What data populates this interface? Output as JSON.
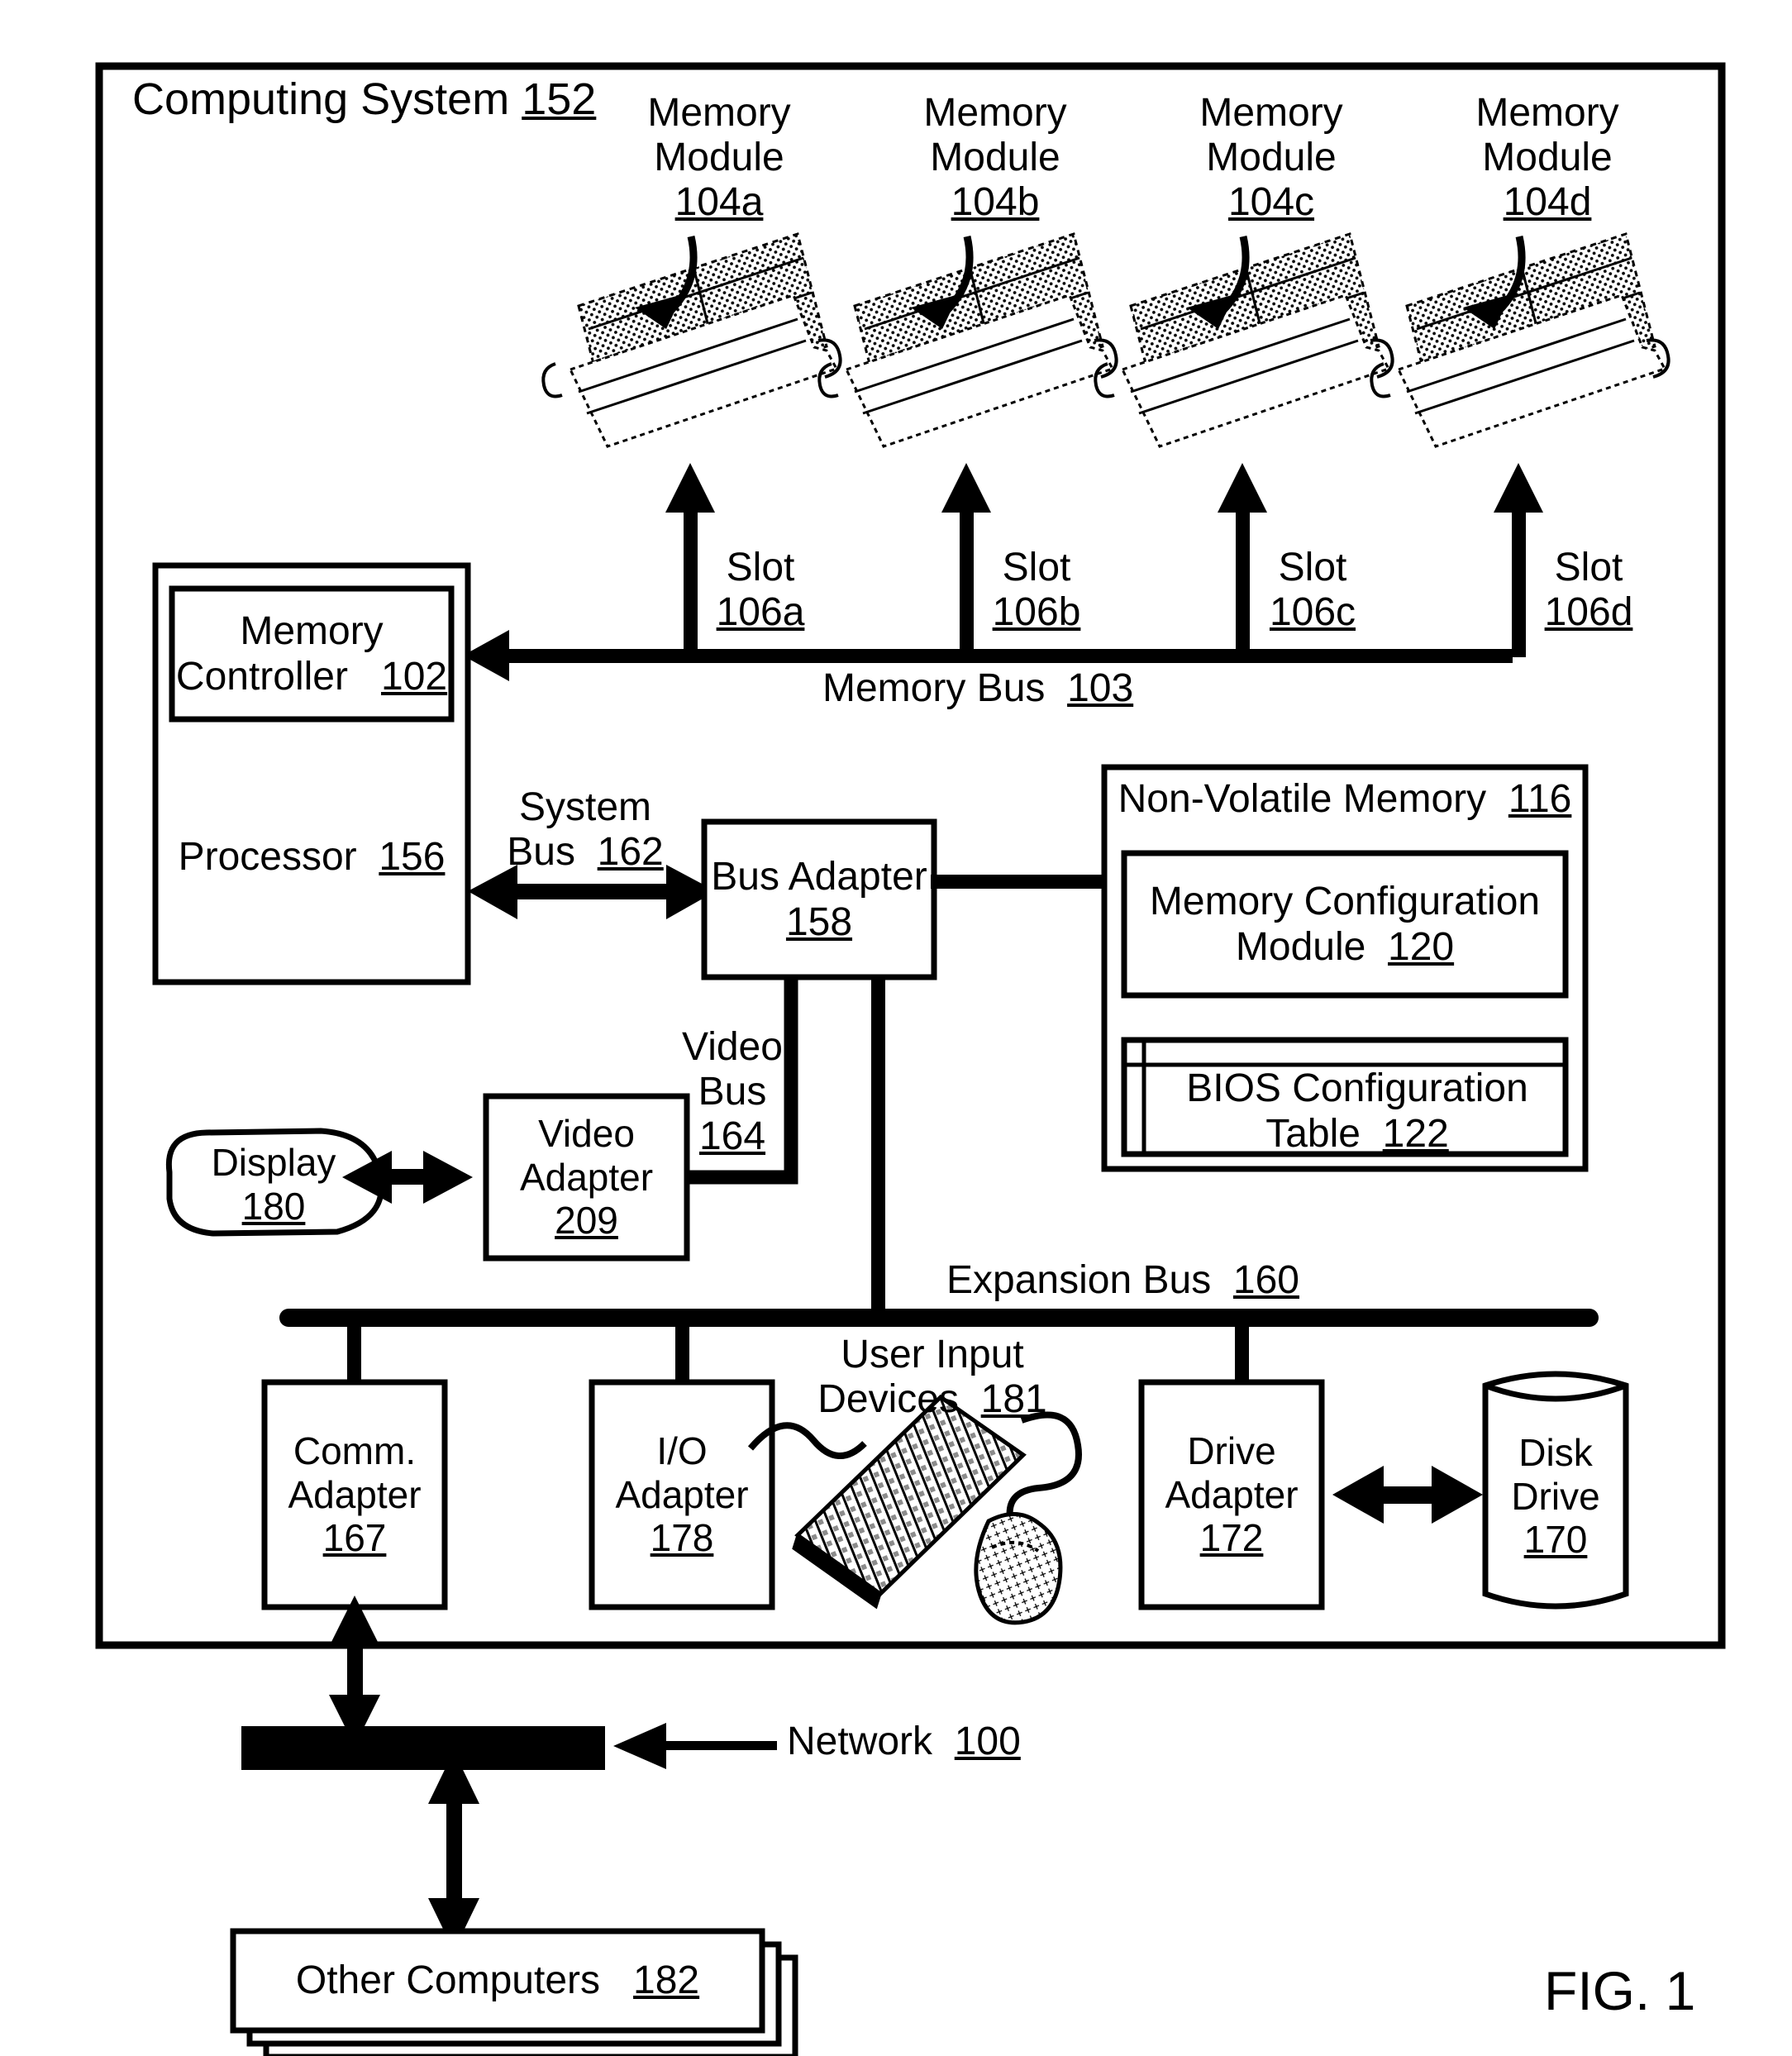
{
  "figure": {
    "caption": "FIG. 1",
    "system_title": "Computing System",
    "system_ref": "152"
  },
  "memory_modules": [
    {
      "line1": "Memory",
      "line2": "Module",
      "ref": "104a"
    },
    {
      "line1": "Memory",
      "line2": "Module",
      "ref": "104b"
    },
    {
      "line1": "Memory",
      "line2": "Module",
      "ref": "104c"
    },
    {
      "line1": "Memory",
      "line2": "Module",
      "ref": "104d"
    }
  ],
  "slots": [
    {
      "label": "Slot",
      "ref": "106a"
    },
    {
      "label": "Slot",
      "ref": "106b"
    },
    {
      "label": "Slot",
      "ref": "106c"
    },
    {
      "label": "Slot",
      "ref": "106d"
    }
  ],
  "buses": {
    "memory_bus": {
      "label": "Memory Bus",
      "ref": "103"
    },
    "system_bus": {
      "line1": "System",
      "line2": "Bus",
      "ref": "162"
    },
    "video_bus": {
      "line1": "Video",
      "line2": "Bus",
      "ref": "164"
    },
    "expansion_bus": {
      "label": "Expansion Bus",
      "ref": "160"
    },
    "network": {
      "label": "Network",
      "ref": "100"
    }
  },
  "blocks": {
    "memory_controller": {
      "line1": "Memory",
      "line2": "Controller",
      "ref": "102"
    },
    "processor": {
      "label": "Processor",
      "ref": "156"
    },
    "bus_adapter": {
      "label": "Bus Adapter",
      "ref": "158"
    },
    "non_volatile_memory": {
      "label": "Non-Volatile Memory",
      "ref": "116"
    },
    "memory_configuration_module": {
      "line1": "Memory Configuration",
      "line2": "Module",
      "ref": "120"
    },
    "bios_configuration_table": {
      "line1": "BIOS Configuration",
      "line2": "Table",
      "ref": "122"
    },
    "video_adapter": {
      "line1": "Video",
      "line2": "Adapter",
      "ref": "209"
    },
    "display": {
      "label": "Display",
      "ref": "180"
    },
    "comm_adapter": {
      "line1": "Comm.",
      "line2": "Adapter",
      "ref": "167"
    },
    "io_adapter": {
      "line1": "I/O",
      "line2": "Adapter",
      "ref": "178"
    },
    "user_input_devices": {
      "line1": "User Input",
      "line2": "Devices",
      "ref": "181"
    },
    "drive_adapter": {
      "line1": "Drive",
      "line2": "Adapter",
      "ref": "172"
    },
    "disk_drive": {
      "line1": "Disk",
      "line2": "Drive",
      "ref": "170"
    },
    "other_computers": {
      "label": "Other Computers",
      "ref": "182"
    }
  },
  "colors": {
    "ink": "#000000",
    "paper": "#ffffff"
  }
}
